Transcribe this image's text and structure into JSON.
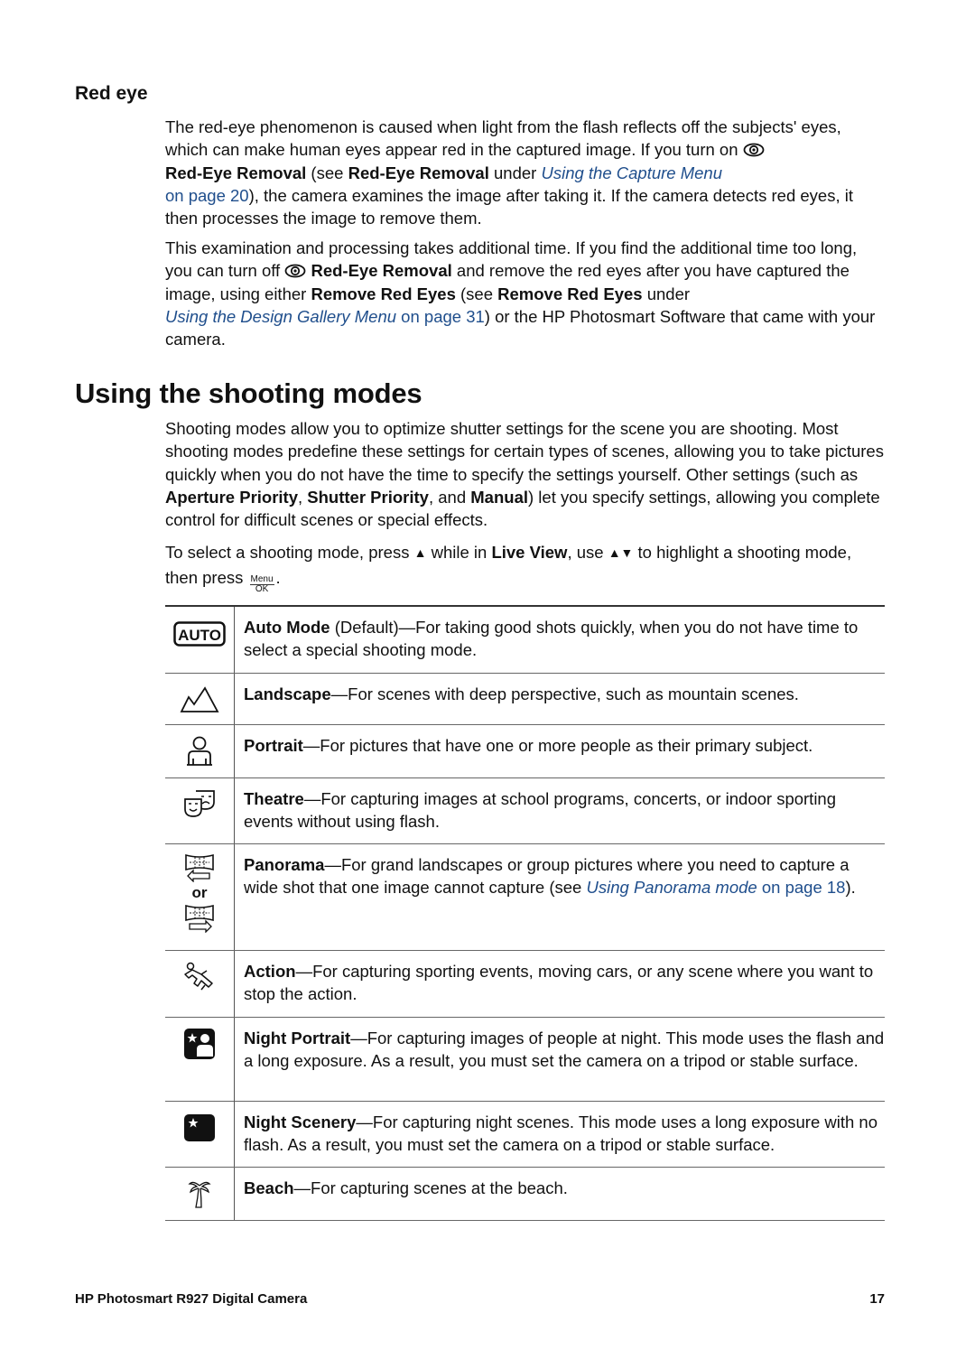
{
  "red_eye": {
    "heading": "Red eye",
    "para1": {
      "t1": "The red-eye phenomenon is caused when light from the flash reflects off the subjects' eyes, which can make human eyes appear red in the captured image. If you turn on ",
      "b1": "Red-Eye Removal",
      "t2": " (see ",
      "b2": "Red-Eye Removal",
      "t3": " under ",
      "link_italic": "Using the Capture Menu",
      "link_plain": " on page 20",
      "t4": "), the camera examines the image after taking it. If the camera detects red eyes, it then processes the image to remove them."
    },
    "para2": {
      "t1": "This examination and processing takes additional time. If you find the additional time too long, you can turn off ",
      "b1": "Red-Eye Removal",
      "t2": " and remove the red eyes after you have captured the image, using either ",
      "b2": "Remove Red Eyes",
      "t3": " (see ",
      "b3": "Remove Red Eyes",
      "t4": " under ",
      "link_italic": "Using the Design Gallery Menu",
      "link_plain": " on page 31",
      "t5": ") or the HP Photosmart Software that came with your camera."
    },
    "icon": "red-eye-icon"
  },
  "shooting_modes": {
    "heading": "Using the shooting modes",
    "para1": {
      "t1": "Shooting modes allow you to optimize shutter settings for the scene you are shooting. Most shooting modes predefine these settings for certain types of scenes, allowing you to take pictures quickly when you do not have the time to specify the settings yourself. Other settings (such as ",
      "b1": "Aperture Priority",
      "t2": ", ",
      "b2": "Shutter Priority",
      "t3": ", and ",
      "b3": "Manual",
      "t4": ") let you specify settings, allowing you complete control for difficult scenes or special effects."
    },
    "para2": {
      "t1": "To select a shooting mode, press ",
      "up_glyph": "▲",
      "t2": " while in ",
      "b1": "Live View",
      "t3": ", use ",
      "updown_glyph": "▲▼",
      "t4": " to highlight a shooting mode, then press ",
      "menu_label": "Menu",
      "ok_label": "OK",
      "t5": "."
    },
    "modes": [
      {
        "icon": "auto-mode-icon",
        "icon_text": "AUTO",
        "name": "Auto Mode",
        "desc": " (Default)—For taking good shots quickly, when you do not have time to select a special shooting mode."
      },
      {
        "icon": "landscape-icon",
        "name": "Landscape",
        "desc": "—For scenes with deep perspective, such as mountain scenes."
      },
      {
        "icon": "portrait-icon",
        "name": "Portrait",
        "desc": "—For pictures that have one or more people as their primary subject."
      },
      {
        "icon": "theatre-icon",
        "name": "Theatre",
        "desc": "—For capturing images at school programs, concerts, or indoor sporting events without using flash."
      },
      {
        "icon": "panorama-icon",
        "or_label": "or",
        "name": "Panorama",
        "desc": "—For grand landscapes or group pictures where you need to capture a wide shot that one image cannot capture (see ",
        "link_italic": "Using Panorama mode",
        "link_plain": " on page 18",
        "desc_end": ")."
      },
      {
        "icon": "action-icon",
        "name": "Action",
        "desc": "—For capturing sporting events, moving cars, or any scene where you want to stop the action."
      },
      {
        "icon": "night-portrait-icon",
        "name": "Night Portrait",
        "desc": "—For capturing images of people at night. This mode uses the flash and a long exposure. As a result, you must set the camera on a tripod or stable surface."
      },
      {
        "icon": "night-scenery-icon",
        "name": "Night Scenery",
        "desc": "—For capturing night scenes. This mode uses a long exposure with no flash. As a result, you must set the camera on a tripod or stable surface."
      },
      {
        "icon": "beach-icon",
        "name": "Beach",
        "desc": "—For capturing scenes at the beach."
      }
    ]
  },
  "footer": {
    "title": "HP Photosmart R927 Digital Camera",
    "page_number": "17"
  },
  "colors": {
    "link": "#1f4e8c",
    "text": "#111111"
  }
}
